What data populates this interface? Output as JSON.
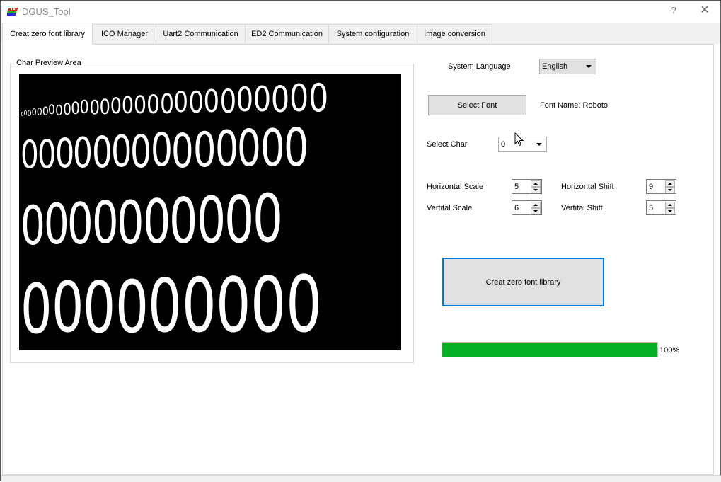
{
  "window": {
    "title": "DGUS_Tool",
    "help_label": "?",
    "close_label": "✕",
    "app_icon": "dgus-logo-icon"
  },
  "tabs": [
    {
      "label": "Creat zero font library",
      "active": true
    },
    {
      "label": "ICO Manager",
      "active": false
    },
    {
      "label": "Uart2 Communication",
      "active": false
    },
    {
      "label": "ED2 Communication",
      "active": false
    },
    {
      "label": "System configuration",
      "active": false
    },
    {
      "label": "Image conversion",
      "active": false
    }
  ],
  "preview": {
    "group_label": "Char Preview Area",
    "char": "0",
    "rows": [
      {
        "count": 27,
        "description": "increasing sizes"
      },
      {
        "count": 14
      },
      {
        "count": 10
      },
      {
        "count": 9
      }
    ]
  },
  "settings": {
    "system_language_label": "System Language",
    "system_language_value": "English",
    "select_font_button": "Select Font",
    "font_name_label": "Font Name: Roboto",
    "select_char_label": "Select Char",
    "select_char_value": "0",
    "horizontal_scale_label": "Horizontal Scale",
    "horizontal_scale_value": "5",
    "vertical_scale_label": "Vertital Scale",
    "vertical_scale_value": "6",
    "horizontal_shift_label": "Horizontal Shift",
    "horizontal_shift_value": "9",
    "vertical_shift_label": "Vertital Shift",
    "vertical_shift_value": "5",
    "create_button": "Creat zero font library"
  },
  "progress": {
    "percent": 100,
    "text": "100%",
    "color": "#06b025"
  },
  "colors": {
    "focus_border": "#0078d7",
    "preview_bg": "#000000",
    "preview_fg": "#ffffff"
  }
}
